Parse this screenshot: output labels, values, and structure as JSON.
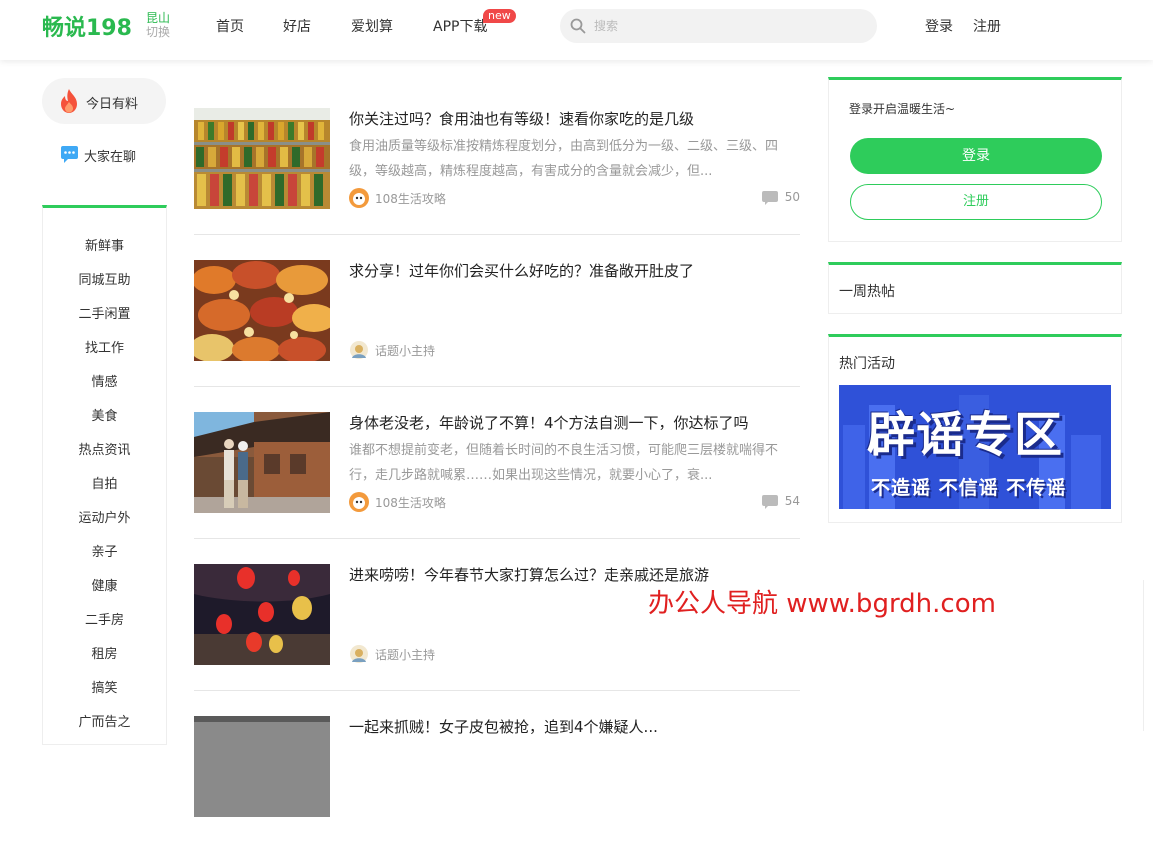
{
  "header": {
    "logo": "畅说198",
    "city": "昆山",
    "city_switch": "切换",
    "nav": [
      "首页",
      "好店",
      "爱划算",
      "APP下载"
    ],
    "new_badge": "new",
    "search_placeholder": "搜索",
    "login": "登录",
    "register": "注册"
  },
  "sidebar": {
    "today": "今日有料",
    "chat": "大家在聊",
    "categories": [
      "新鲜事",
      "同城互助",
      "二手闲置",
      "找工作",
      "情感",
      "美食",
      "热点资讯",
      "自拍",
      "运动户外",
      "亲子",
      "健康",
      "二手房",
      "租房",
      "搞笑",
      "广而告之"
    ]
  },
  "feed": [
    {
      "title": "你关注过吗？食用油也有等级！速看你家吃的是几级",
      "excerpt": "食用油质量等级标准按精炼程度划分，由高到低分为一级、二级、三级、四级，等级越高，精炼程度越高，有害成分的含量就会减少，但...",
      "author": "108生活攻略",
      "comments": "50"
    },
    {
      "title": "求分享！过年你们会买什么好吃的？准备敞开肚皮了",
      "excerpt": "",
      "author": "话题小主持",
      "comments": ""
    },
    {
      "title": "身体老没老，年龄说了不算！4个方法自测一下，你达标了吗",
      "excerpt": "谁都不想提前变老，但随着长时间的不良生活习惯，可能爬三层楼就喘得不行，走几步路就喊累……如果出现这些情况，就要小心了，衰...",
      "author": "108生活攻略",
      "comments": "54"
    },
    {
      "title": "进来唠唠！今年春节大家打算怎么过？走亲戚还是旅游",
      "excerpt": "",
      "author": "话题小主持",
      "comments": ""
    },
    {
      "title": "一起来抓贼！女子皮包被抢，追到4个嫌疑人...",
      "excerpt": "",
      "author": "",
      "comments": ""
    }
  ],
  "right": {
    "login_prompt": "登录开启温暖生活~",
    "login_btn": "登录",
    "register_btn": "注册",
    "hot_posts": "一周热帖",
    "hot_events": "热门活动",
    "promo_big": "辟谣专区",
    "promo_small": "不造谣 不信谣 不传谣"
  },
  "watermark": "办公人导航 www.bgrdh.com",
  "colors": {
    "brand": "#2ecc5b",
    "badge": "#f04848",
    "watermark": "#e02020"
  }
}
